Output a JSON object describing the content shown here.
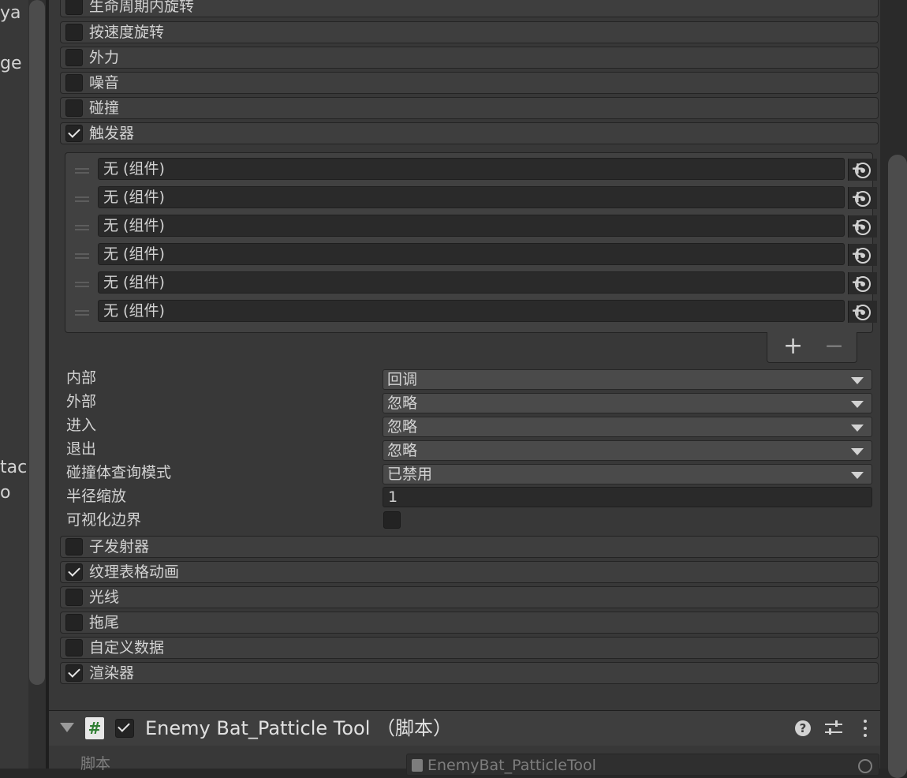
{
  "left_panel": {
    "fragments": [
      "ya",
      "ge",
      "tac",
      "o"
    ]
  },
  "modules_top": [
    {
      "label": "生命周期内旋转",
      "enabled": false
    },
    {
      "label": "按速度旋转",
      "enabled": false
    },
    {
      "label": "外力",
      "enabled": false
    },
    {
      "label": "噪音",
      "enabled": false
    },
    {
      "label": "碰撞",
      "enabled": false
    },
    {
      "label": "触发器",
      "enabled": true
    }
  ],
  "trigger": {
    "colliders": [
      {
        "value": "无 (组件)"
      },
      {
        "value": "无 (组件)"
      },
      {
        "value": "无 (组件)"
      },
      {
        "value": "无 (组件)"
      },
      {
        "value": "无 (组件)"
      },
      {
        "value": "无 (组件)"
      }
    ],
    "add_label": "+",
    "remove_label": "−",
    "properties": {
      "inside": {
        "label": "内部",
        "value": "回调"
      },
      "outside": {
        "label": "外部",
        "value": "忽略"
      },
      "enter": {
        "label": "进入",
        "value": "忽略"
      },
      "exit": {
        "label": "退出",
        "value": "忽略"
      },
      "collider_query_mode": {
        "label": "碰撞体查询模式",
        "value": "已禁用"
      },
      "radius_scale": {
        "label": "半径缩放",
        "value": "1"
      },
      "visualize_bounds": {
        "label": "可视化边界",
        "checked": false
      }
    }
  },
  "modules_bottom": [
    {
      "label": "子发射器",
      "enabled": false
    },
    {
      "label": "纹理表格动画",
      "enabled": true
    },
    {
      "label": "光线",
      "enabled": false
    },
    {
      "label": "拖尾",
      "enabled": false
    },
    {
      "label": "自定义数据",
      "enabled": false
    },
    {
      "label": "渲染器",
      "enabled": true
    }
  ],
  "component": {
    "icon_glyph": "#",
    "enabled": true,
    "title": "Enemy Bat_Patticle Tool （脚本）",
    "help_glyph": "?",
    "script_label": "脚本",
    "script_value": "EnemyBat_PatticleTool"
  },
  "colors": {
    "panel": "#383838",
    "module_header": "#3e3e3e",
    "field": "#2a2a2a",
    "script_icon_green": "#2e7d32"
  }
}
